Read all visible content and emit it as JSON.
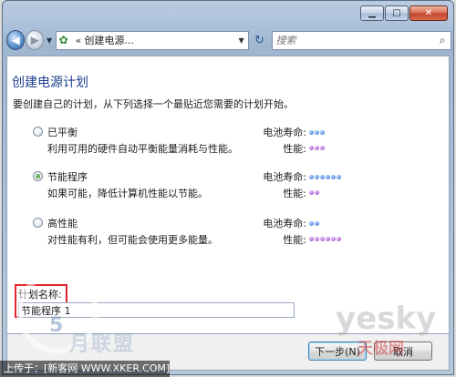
{
  "window": {
    "caption": {
      "minimize": "▁",
      "maximize": "□",
      "close": "✕"
    }
  },
  "navbar": {
    "back_icon": "back-arrow-icon",
    "forward_icon": "forward-arrow-icon",
    "address_chevron": "«",
    "address_text": "创建电源...",
    "search_placeholder": "搜索"
  },
  "main": {
    "title": "创建电源计划",
    "subtitle": "要创建自己的计划，从下列选择一个最贴近您需要的计划开始。",
    "battery_label": "电池寿命:",
    "performance_label": "性能:",
    "plans": [
      {
        "name": "已平衡",
        "description": "利用可用的硬件自动平衡能量消耗与性能。",
        "checked": false,
        "battery": 3,
        "performance": 3
      },
      {
        "name": "节能程序",
        "description": "如果可能，降低计算机性能以节能。",
        "checked": true,
        "battery": 6,
        "performance": 2
      },
      {
        "name": "高性能",
        "description": "对性能有利，但可能会使用更多能量。",
        "checked": false,
        "battery": 2,
        "performance": 6
      }
    ],
    "plan_name_label": "计划名称:",
    "plan_name_value": "节能程序 1"
  },
  "footer": {
    "next_label": "下一步(N)",
    "cancel_label": "取消"
  },
  "watermark": {
    "ring_number": "5",
    "logo_text": "月联盟",
    "yesky": "yesky",
    "tianji": "天极网",
    "upload_text": "上传于：[新客网 WWW.XKER.COM]"
  },
  "colors": {
    "title": "#1e3f8f",
    "battery_dot": "#2f6ed3",
    "performance_dot": "#8b3cc0",
    "highlight_box": "#e2262d"
  }
}
